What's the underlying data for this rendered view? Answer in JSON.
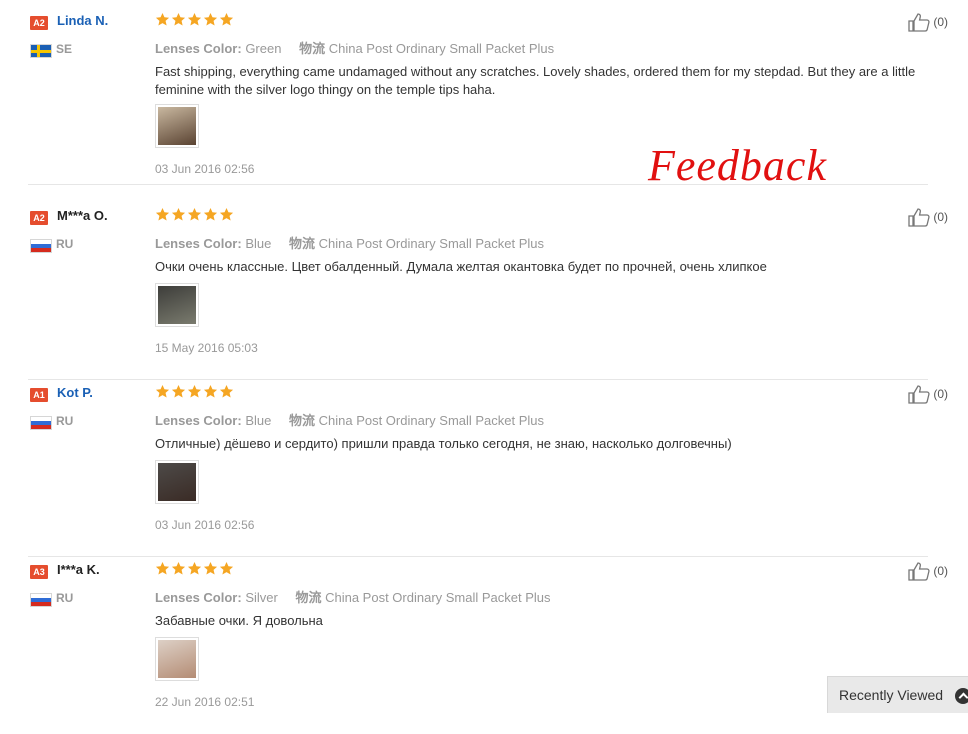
{
  "reviews": [
    {
      "level": "A2",
      "user": "Linda N.",
      "user_style": "link",
      "country": "SE",
      "flag": "se",
      "rating": 5,
      "lens_label": "Lenses Color:",
      "lens_value": "Green",
      "ship_label": "物流",
      "ship_value": "China Post Ordinary Small Packet Plus",
      "text": "Fast shipping, everything came undamaged without any scratches. Lovely shades, ordered them for my stepdad. But they are a little feminine with the silver logo thingy on the temple tips haha.",
      "date": "03 Jun 2016 02:56",
      "helpful": "(0)",
      "photo_colors": [
        "#c9b8a0",
        "#5a4332"
      ]
    },
    {
      "level": "A2",
      "user": "M***a O.",
      "user_style": "plain",
      "country": "RU",
      "flag": "ru",
      "rating": 5,
      "lens_label": "Lenses Color:",
      "lens_value": "Blue",
      "ship_label": "物流",
      "ship_value": "China Post Ordinary Small Packet Plus",
      "text": "Очки очень классные. Цвет обалденный. Думала желтая окантовка будет по прочней, очень хлипкое",
      "date": "15 May 2016 05:03",
      "helpful": "(0)",
      "photo_colors": [
        "#3d3d3a",
        "#7a7b6e"
      ]
    },
    {
      "level": "A1",
      "user": "Kot P.",
      "user_style": "link",
      "country": "RU",
      "flag": "ru",
      "rating": 5,
      "lens_label": "Lenses Color:",
      "lens_value": "Blue",
      "ship_label": "物流",
      "ship_value": "China Post Ordinary Small Packet Plus",
      "text": "Отличные) дёшево и сердито) пришли правда только сегодня, не знаю, насколько долговечны)",
      "date": "03 Jun 2016 02:56",
      "helpful": "(0)",
      "photo_colors": [
        "#4d4a48",
        "#3a2b25"
      ]
    },
    {
      "level": "A3",
      "user": "I***a K.",
      "user_style": "plain",
      "country": "RU",
      "flag": "ru",
      "rating": 5,
      "lens_label": "Lenses Color:",
      "lens_value": "Silver",
      "ship_label": "物流",
      "ship_value": "China Post Ordinary Small Packet Plus",
      "text": "Забавные очки. Я довольна",
      "date": "22 Jun 2016 02:51",
      "helpful": "(0)",
      "photo_colors": [
        "#ddd0c6",
        "#b48c74"
      ]
    }
  ],
  "watermark": "Feedback",
  "recently_viewed": {
    "label": "Recently Viewed"
  },
  "colors": {
    "star": "#f5a623",
    "link": "#1a60b5",
    "badge": "#e54d2e",
    "watermark": "#e11010"
  },
  "icons": {
    "star": "star-icon",
    "thumbs_up": "thumbs-up-icon",
    "chevron": "chevron-up-icon"
  }
}
